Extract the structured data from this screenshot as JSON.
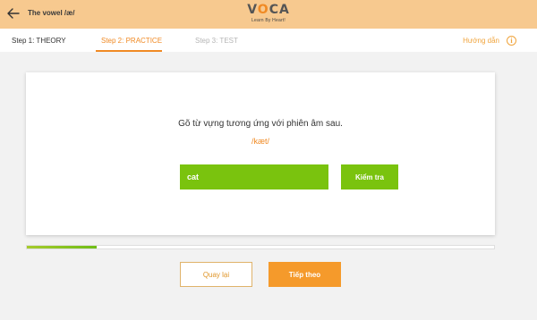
{
  "header": {
    "title": "The vowel /æ/",
    "logo": {
      "word_start": "V",
      "word_o1": "O",
      "word_c": "C",
      "word_a": "A",
      "tagline": "Learn By Heart!"
    }
  },
  "steps": {
    "items": [
      {
        "label": "Step 1: THEORY"
      },
      {
        "label": "Step 2: PRACTICE",
        "active": true
      },
      {
        "label": "Step 3: TEST"
      }
    ],
    "guide_label": "Hướng dẫn",
    "guide_icon": "info-icon"
  },
  "exercise": {
    "instruction": "Gõ từ vựng tương ứng với phiên âm sau.",
    "phonetic": "/kæt/",
    "answer_value": "cat",
    "check_label": "Kiểm tra"
  },
  "progress": {
    "fraction": 0.15
  },
  "nav": {
    "back_label": "Quay lại",
    "next_label": "Tiếp theo"
  },
  "colors": {
    "header_bg": "#f7c98f",
    "accent_orange": "#f08a24",
    "accent_green": "#7ac30e"
  }
}
